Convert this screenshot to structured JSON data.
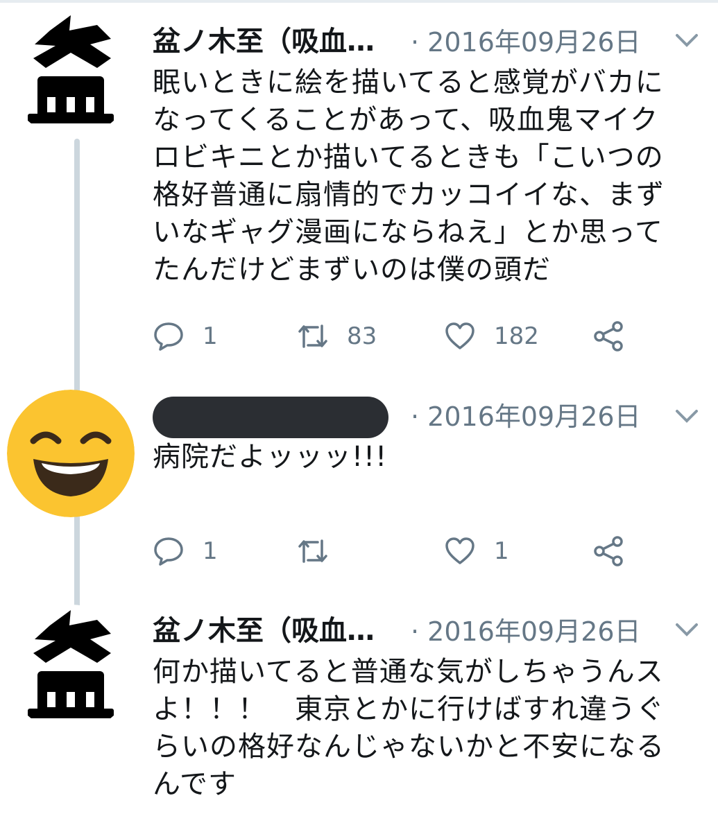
{
  "tweets": [
    {
      "author": "盆ノ木至（吸血…",
      "date": "· 2016年09月26日",
      "lines": [
        "眠いときに絵を描いてると感覚がバカに",
        "なってくることがあって、吸血鬼マイク",
        "ロビキニとか描いてるときも「こいつの",
        "格好普通に扇情的でカッコイイな、まず",
        "いなギャグ漫画にならねえ」とか思って",
        "たんだけどまずいのは僕の頭だ"
      ],
      "replies": "1",
      "retweets": "83",
      "likes": "182"
    },
    {
      "author": "",
      "author_redacted": true,
      "date": "· 2016年09月26日",
      "lines": [
        "病院だよッッッ!!!"
      ],
      "replies": "1",
      "retweets": "",
      "likes": "1"
    },
    {
      "author": "盆ノ木至（吸血…",
      "date": "· 2016年09月26日",
      "lines": [
        "何か描いてると普通な気がしちゃうんス",
        "よ！！！　東京とかに行けばすれ違うぐ",
        "らいの格好なんじゃないかと不安になる",
        "んです"
      ]
    }
  ],
  "avatar_bon_glyph": "盆",
  "icons": {
    "reply": "reply-icon",
    "retweet": "retweet-icon",
    "like": "heart-icon",
    "share": "share-icon",
    "menu": "chevron-down-icon"
  },
  "colors": {
    "text": "#14171a",
    "muted": "#657786",
    "thread_line": "#ccd6dd",
    "emoji_face": "#fbc430"
  }
}
